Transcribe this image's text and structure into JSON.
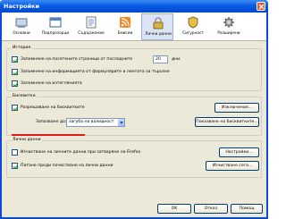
{
  "window": {
    "title": "Настройки"
  },
  "toolbar": {
    "items": [
      {
        "label": "Основни",
        "icon": "general-icon"
      },
      {
        "label": "Подпрозорци",
        "icon": "tabs-icon"
      },
      {
        "label": "Съдържание",
        "icon": "content-icon"
      },
      {
        "label": "Емисии",
        "icon": "feeds-icon"
      },
      {
        "label": "Лични данни",
        "icon": "privacy-icon",
        "active": true
      },
      {
        "label": "Сигурност",
        "icon": "security-icon"
      },
      {
        "label": "Разширени",
        "icon": "advanced-icon"
      }
    ]
  },
  "history": {
    "title": "История",
    "visited_label": "Запомняне на посетените страници от последните",
    "visited_days": "20",
    "days_unit": "дни.",
    "forms_label": "Запомняне на информацията от формулярите и лентата за търсене",
    "downloads_label": "Запомняне на изтеглянията"
  },
  "cookies": {
    "title": "Бисквитки",
    "allow_label": "Разрешаване на бисквитките",
    "exceptions_button": "Изключения...",
    "keep_until_label": "Запазване до:",
    "keep_until_value": "загуба на валидност",
    "show_cookies_button": "Показване на бисквитките..."
  },
  "private_data": {
    "title": "Лични данни",
    "clear_on_close_label": "Изчистване на личните данни при затваряне на Firefox",
    "settings_button": "Настройки...",
    "ask_before_clear_label": "Питане преди почистване на лични данни",
    "clear_now_button": "Изчистване сега..."
  },
  "footer": {
    "ok_button": "OK",
    "cancel_button": "Отказ",
    "help_button": "Помощ"
  },
  "colors": {
    "titlebar": "#0a5ce5",
    "dialog_bg": "#ece9d8",
    "accent_underline": "#e31b1b"
  }
}
